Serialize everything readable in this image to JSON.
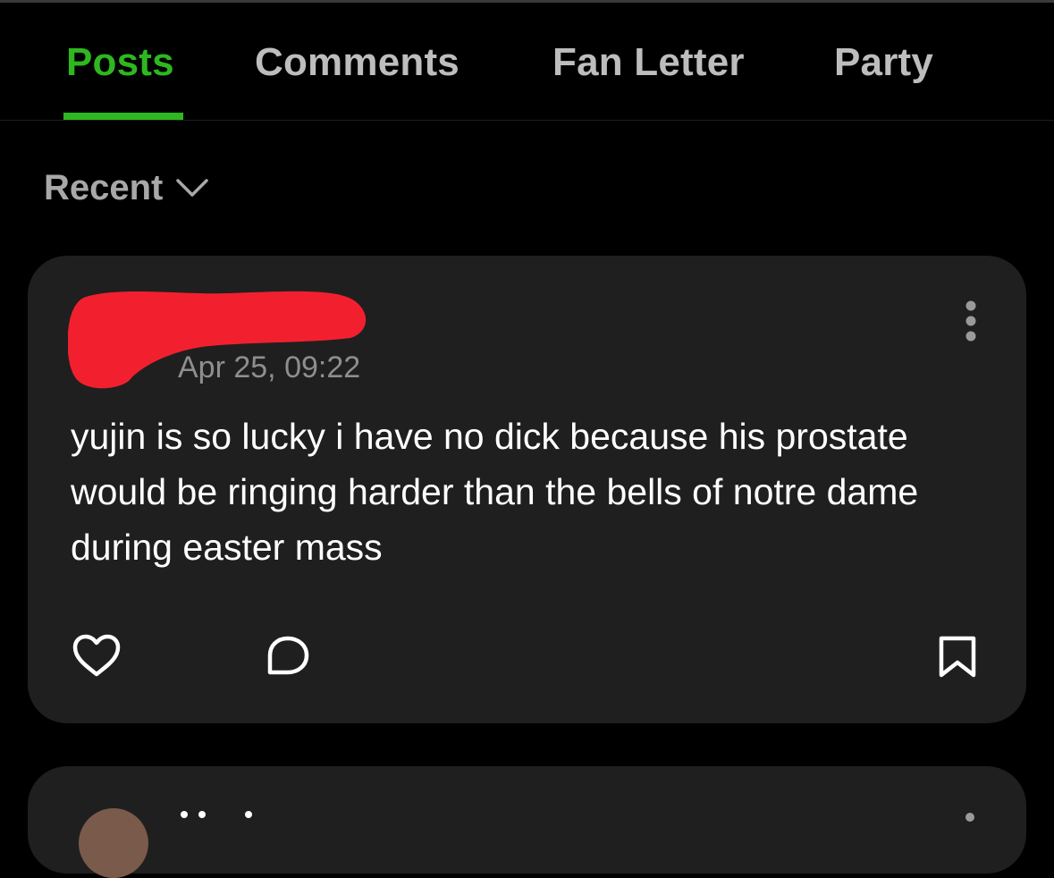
{
  "tabs": [
    {
      "label": "Posts",
      "active": true
    },
    {
      "label": "Comments",
      "active": false
    },
    {
      "label": "Fan Letter",
      "active": false
    },
    {
      "label": "Party",
      "active": false
    }
  ],
  "sort": {
    "label": "Recent",
    "icon": "chevron-down-icon"
  },
  "post": {
    "timestamp": "Apr 25, 09:22",
    "body": "yujin is so lucky i have no dick because his prostate would be ringing harder than the bells of notre dame during easter mass",
    "actions": [
      {
        "icon": "heart-icon"
      },
      {
        "icon": "comment-icon"
      },
      {
        "icon": "bookmark-icon"
      }
    ],
    "menu_icon": "more-vertical-icon"
  },
  "colors": {
    "background": "#000000",
    "accent": "#2db81f",
    "card": "#1f1f1f",
    "tab_inactive": "#bdbdbd",
    "muted": "#8e8e8e",
    "redaction": "#f2202e"
  }
}
